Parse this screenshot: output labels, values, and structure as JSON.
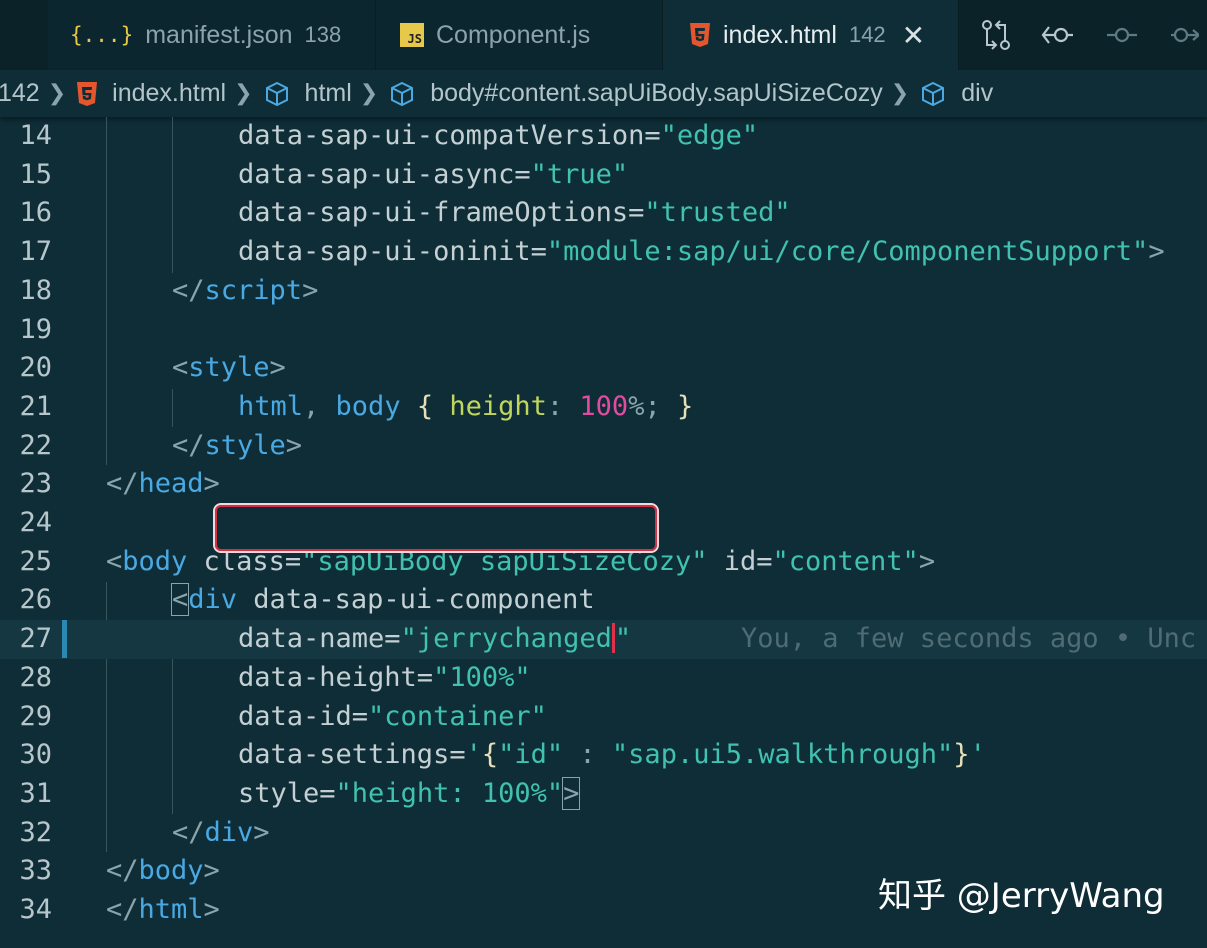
{
  "tabs": [
    {
      "icon": "{...}",
      "label": "manifest.json",
      "count": "138"
    },
    {
      "icon": "JS",
      "label": "Component.js",
      "count": ""
    },
    {
      "icon": "html5",
      "label": "index.html",
      "count": "142",
      "close": "✕"
    }
  ],
  "breadcrumb": {
    "count": "142",
    "items": [
      "index.html",
      "html",
      "body#content.sapUiBody.sapUiSizeCozy",
      "div"
    ]
  },
  "editor": {
    "lines": [
      {
        "n": "14"
      },
      {
        "n": "15"
      },
      {
        "n": "16"
      },
      {
        "n": "17"
      },
      {
        "n": "18"
      },
      {
        "n": "19"
      },
      {
        "n": "20"
      },
      {
        "n": "21"
      },
      {
        "n": "22"
      },
      {
        "n": "23"
      },
      {
        "n": "24"
      },
      {
        "n": "25"
      },
      {
        "n": "26"
      },
      {
        "n": "27"
      },
      {
        "n": "28"
      },
      {
        "n": "29"
      },
      {
        "n": "30"
      },
      {
        "n": "31"
      },
      {
        "n": "32"
      },
      {
        "n": "33"
      },
      {
        "n": "34"
      }
    ],
    "code": {
      "l14": {
        "attr": "data-sap-ui-compatVersion=",
        "val": "\"edge\""
      },
      "l15": {
        "attr": "data-sap-ui-async=",
        "val": "\"true\""
      },
      "l16": {
        "attr": "data-sap-ui-frameOptions=",
        "val": "\"trusted\""
      },
      "l17": {
        "attr": "data-sap-ui-oninit=",
        "val": "\"module:sap/ui/core/ComponentSupport\"",
        "end": ">"
      },
      "l18": {
        "open": "</",
        "tag": "script",
        "close": ">"
      },
      "l20": {
        "open": "<",
        "tag": "style",
        "close": ">"
      },
      "l21": {
        "sel1": "html",
        "comma": ", ",
        "sel2": "body",
        "b1": " { ",
        "prop": "height",
        "colon": ": ",
        "num": "100",
        "pct": "%;",
        "b2": " }"
      },
      "l22": {
        "open": "</",
        "tag": "style",
        "close": ">"
      },
      "l23": {
        "open": "</",
        "tag": "head",
        "close": ">"
      },
      "l25": {
        "open": "<",
        "tag": "body",
        "a1": " class=",
        "v1": "\"sapUiBody sapUiSizeCozy\"",
        "a2": " id=",
        "v2": "\"content\"",
        "close": ">"
      },
      "l26": {
        "open": "<",
        "tag": "div",
        "a1": " data-sap-ui-component"
      },
      "l27": {
        "attr": "data-name=",
        "val": "\"jerrychanged",
        "q": "\"",
        "blame": "You, a few seconds ago • Unc"
      },
      "l28": {
        "attr": "data-height=",
        "val": "\"100%\""
      },
      "l29": {
        "attr": "data-id=",
        "val": "\"container\""
      },
      "l30": {
        "attr": "data-settings=",
        "q1": "'",
        "b1": "{",
        "k": "\"id\"",
        "c": " : ",
        "v": "\"sap.ui5.walkthrough\"",
        "b2": "}",
        "q2": "'"
      },
      "l31": {
        "attr": "style=",
        "val": "\"height: 100%\"",
        "end": ">"
      },
      "l32": {
        "open": "</",
        "tag": "div",
        "close": ">"
      },
      "l33": {
        "open": "</",
        "tag": "body",
        "close": ">"
      },
      "l34": {
        "open": "</",
        "tag": "html",
        "close": ">"
      }
    }
  },
  "watermark": "知乎 @JerryWang"
}
